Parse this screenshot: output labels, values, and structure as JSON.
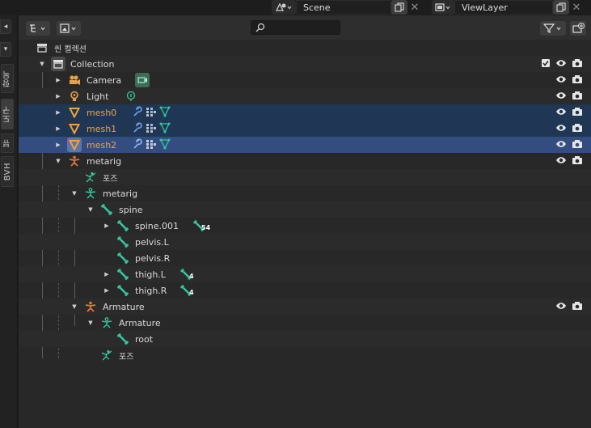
{
  "topbar": {
    "scene_label": "Scene",
    "viewlayer_label": "ViewLayer",
    "close_glyph": "✕"
  },
  "tabs": {
    "small1": "◂",
    "small2": "▾",
    "v1": "항목",
    "v2": "도구",
    "v3": "뷰",
    "v4": "BVH"
  },
  "outliner": {
    "display_mode_icon": "outliner-icon",
    "filter_icon": "funnel-icon",
    "search_placeholder": "",
    "scene_collection": "씬 컬렉션",
    "collection": "Collection",
    "camera": "Camera",
    "light": "Light",
    "mesh0": "mesh0",
    "mesh1": "mesh1",
    "mesh2": "mesh2",
    "metarig": "metarig",
    "pose": "포즈",
    "metarig_data": "metarig",
    "spine": "spine",
    "spine001": "spine.001",
    "spine001_count": "54",
    "pelvisL": "pelvis.L",
    "pelvisR": "pelvis.R",
    "thighL": "thigh.L",
    "thighL_count": "4",
    "thighR": "thigh.R",
    "thighR_count": "4",
    "armature": "Armature",
    "armature_data": "Armature",
    "root": "root",
    "pose2": "포즈"
  },
  "colors": {
    "selected_row": "#1f3754",
    "active_row": "#334d80",
    "mesh_orange": "#f2a13c",
    "bone_teal": "#2fc1a4",
    "armature_orange": "#e2783a"
  }
}
